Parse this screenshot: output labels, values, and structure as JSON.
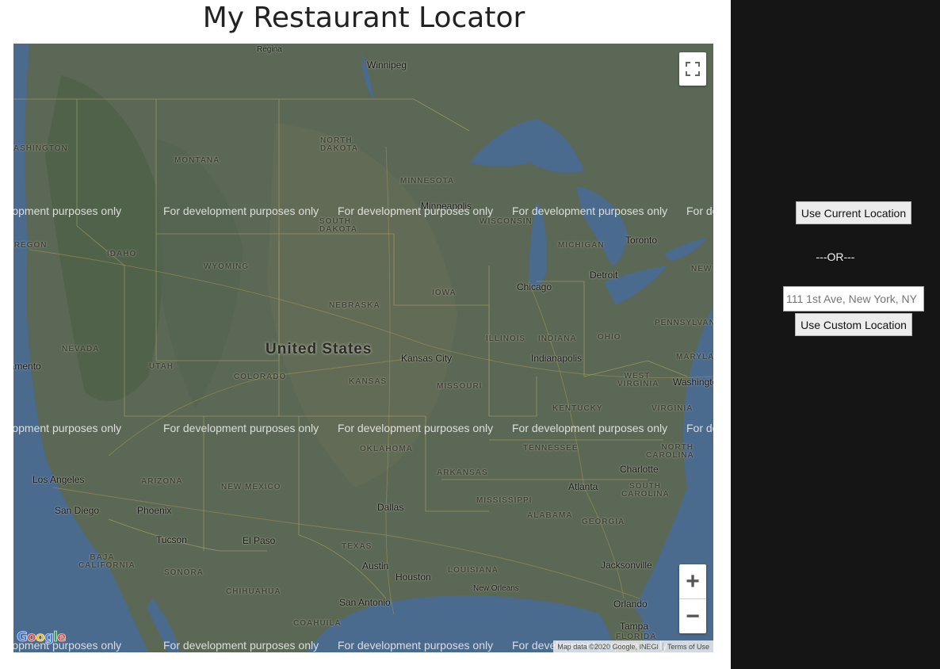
{
  "page_title": "My Restaurant Locator",
  "map": {
    "country_label": "United States",
    "state_labels": [
      "MONTANA",
      "NORTH DAKOTA",
      "MINNESOTA",
      "SOUTH DAKOTA",
      "WISCONSIN",
      "MICHIGAN",
      "IDAHO",
      "WYOMING",
      "IOWA",
      "NEBRASKA",
      "NEVADA",
      "UTAH",
      "COLORADO",
      "KANSAS",
      "MISSOURI",
      "ILLINOIS",
      "INDIANA",
      "OHIO",
      "PENNSYLVANIA",
      "WEST VIRGINIA",
      "VIRGINIA",
      "KENTUCKY",
      "TENNESSEE",
      "NORTH CAROLINA",
      "OKLAHOMA",
      "ARKANSAS",
      "ARIZONA",
      "NEW MEXICO",
      "MISSISSIPPI",
      "ALABAMA",
      "GEORGIA",
      "SOUTH CAROLINA",
      "TEXAS",
      "LOUISIANA",
      "FLORIDA",
      "MARYLAND",
      "BAJA CALIFORNIA",
      "SONORA",
      "CHIHUAHUA",
      "COAHUILA",
      "OREGON",
      "WASHINGTON",
      "NEW"
    ],
    "city_labels": [
      "Regina",
      "Winnipeg",
      "Minneapolis",
      "Toronto",
      "Detroit",
      "Chicago",
      "Kansas City",
      "Indianapolis",
      "Washington",
      "Charlotte",
      "Atlanta",
      "Los Angeles",
      "San Diego",
      "Phoenix",
      "Tucson",
      "El Paso",
      "Dallas",
      "Austin",
      "Houston",
      "San Antonio",
      "New Orleans",
      "Jacksonville",
      "Orlando",
      "Tampa",
      "Sacramento"
    ],
    "dev_watermark": "For development purposes only",
    "logo_text": "Google",
    "attribution": "Map data ©2020 Google, INEGI",
    "terms_link": "Terms of Use",
    "zoom_in": "+",
    "zoom_out": "−",
    "fullscreen_icon": "fullscreen-icon"
  },
  "sidebar": {
    "current_location_button": "Use Current Location",
    "or_divider": "---OR---",
    "address_input_value": "",
    "address_input_placeholder": "111 1st Ave, New York, NY",
    "custom_location_button": "Use Custom Location"
  },
  "colors": {
    "sidebar_bg": "#151515",
    "water": "#4a6a8e",
    "land": "#5b6855"
  }
}
